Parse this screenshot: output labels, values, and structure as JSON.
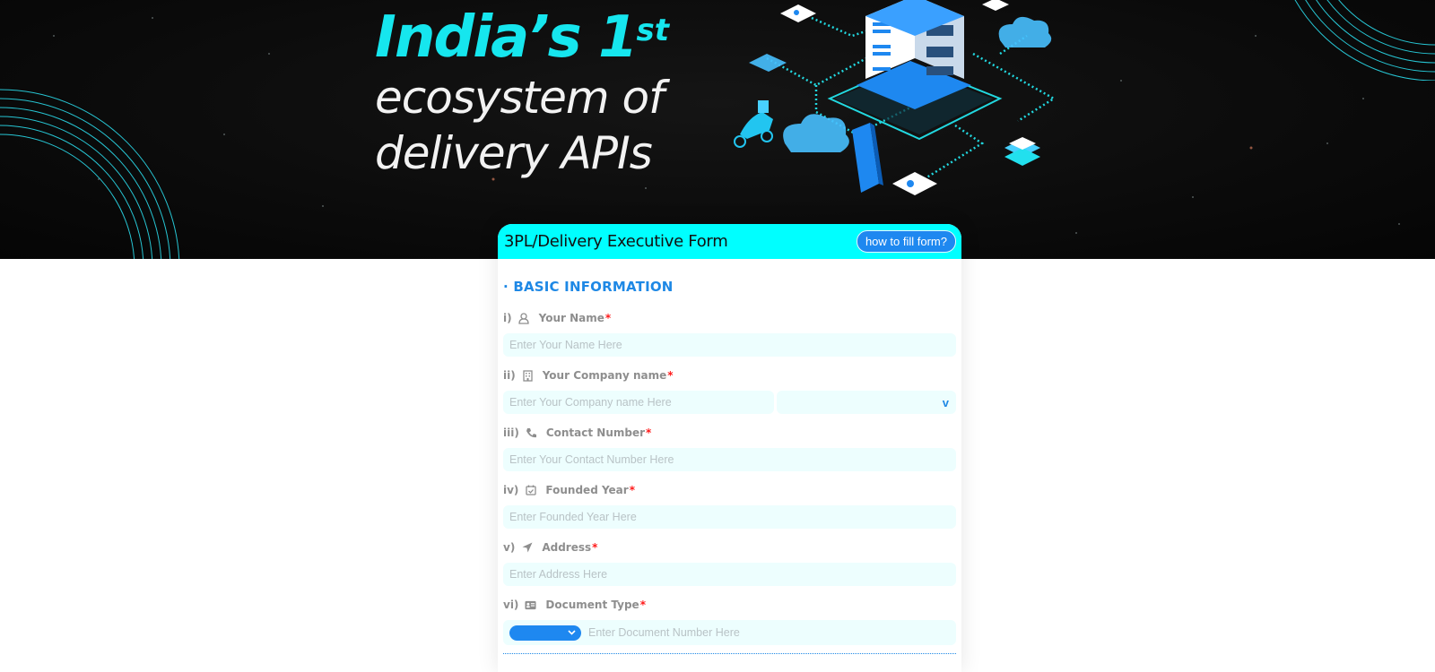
{
  "hero": {
    "line1_main": "India’s 1",
    "line1_sup": "st",
    "line2": "ecosystem of",
    "line3": "delivery APIs"
  },
  "form": {
    "title": "3PL/Delivery Executive Form",
    "help_button": "how to fill form?",
    "section_title": "· BASIC INFORMATION",
    "required_mark": "*",
    "fields": [
      {
        "num": "i)",
        "label": "Your Name",
        "icon": "user-icon",
        "placeholder": "Enter Your Name Here"
      },
      {
        "num": "ii)",
        "label": "Your Company name",
        "icon": "building-icon",
        "placeholder": "Enter Your Company name Here",
        "dropdown_arrow": "v"
      },
      {
        "num": "iii)",
        "label": "Contact Number",
        "icon": "phone-icon",
        "placeholder": "Enter Your Contact Number Here"
      },
      {
        "num": "iv)",
        "label": "Founded Year",
        "icon": "calendar-check-icon",
        "placeholder": "Enter Founded Year Here"
      },
      {
        "num": "v)",
        "label": "Address",
        "icon": "location-arrow-icon",
        "placeholder": "Enter Address Here"
      },
      {
        "num": "vi)",
        "label": "Document Type",
        "icon": "id-card-icon",
        "placeholder": "Enter Document Number Here",
        "select_value": ""
      }
    ]
  },
  "colors": {
    "accent_cyan": "#00ffff",
    "hero_text_cyan": "#16e6ee",
    "primary_blue": "#1e88f0",
    "required_red": "#ff1a1a",
    "input_bg": "#edfefe"
  }
}
